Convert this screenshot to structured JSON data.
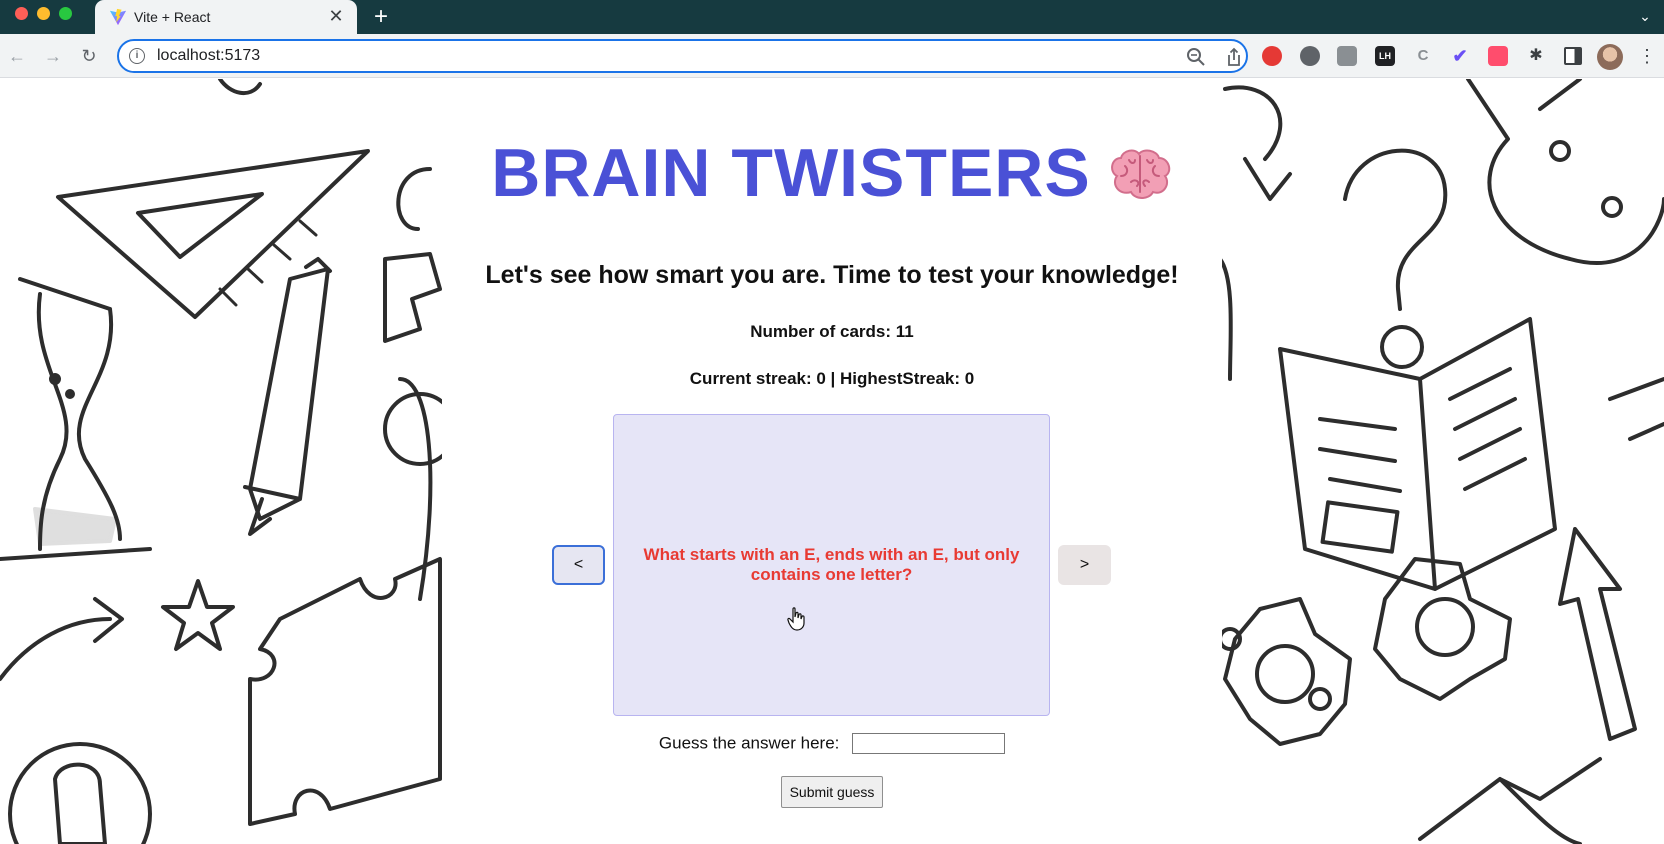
{
  "browser": {
    "tab_title": "Vite + React",
    "tab_favicon": "vite-logo-icon",
    "new_tab_label": "+",
    "url": "localhost:5173",
    "extensions": [
      "adblock-icon",
      "gear-icon",
      "notes-icon",
      "lh-extension-icon",
      "c-extension-icon",
      "check-extension-icon",
      "dice-extension-icon",
      "puzzle-icon",
      "side-panel-icon"
    ],
    "lh_label": "LH"
  },
  "app": {
    "title": "BRAIN TWISTERS",
    "title_icon": "brain-icon",
    "title_color": "#4a51d6",
    "subtitle": "Let's see how smart you are. Time to test your knowledge!",
    "card_count_text": "Number of cards: 11",
    "streak_text": "Current streak: 0 | HighestStreak: 0",
    "prev_label": "<",
    "next_label": ">",
    "card": {
      "question": "What starts with an E, ends with an E, but only contains one letter?",
      "background": "#e6e5f7",
      "text_color": "#e83a33"
    },
    "guess_label": "Guess the answer here:",
    "guess_value": "",
    "submit_label": "Submit guess"
  }
}
